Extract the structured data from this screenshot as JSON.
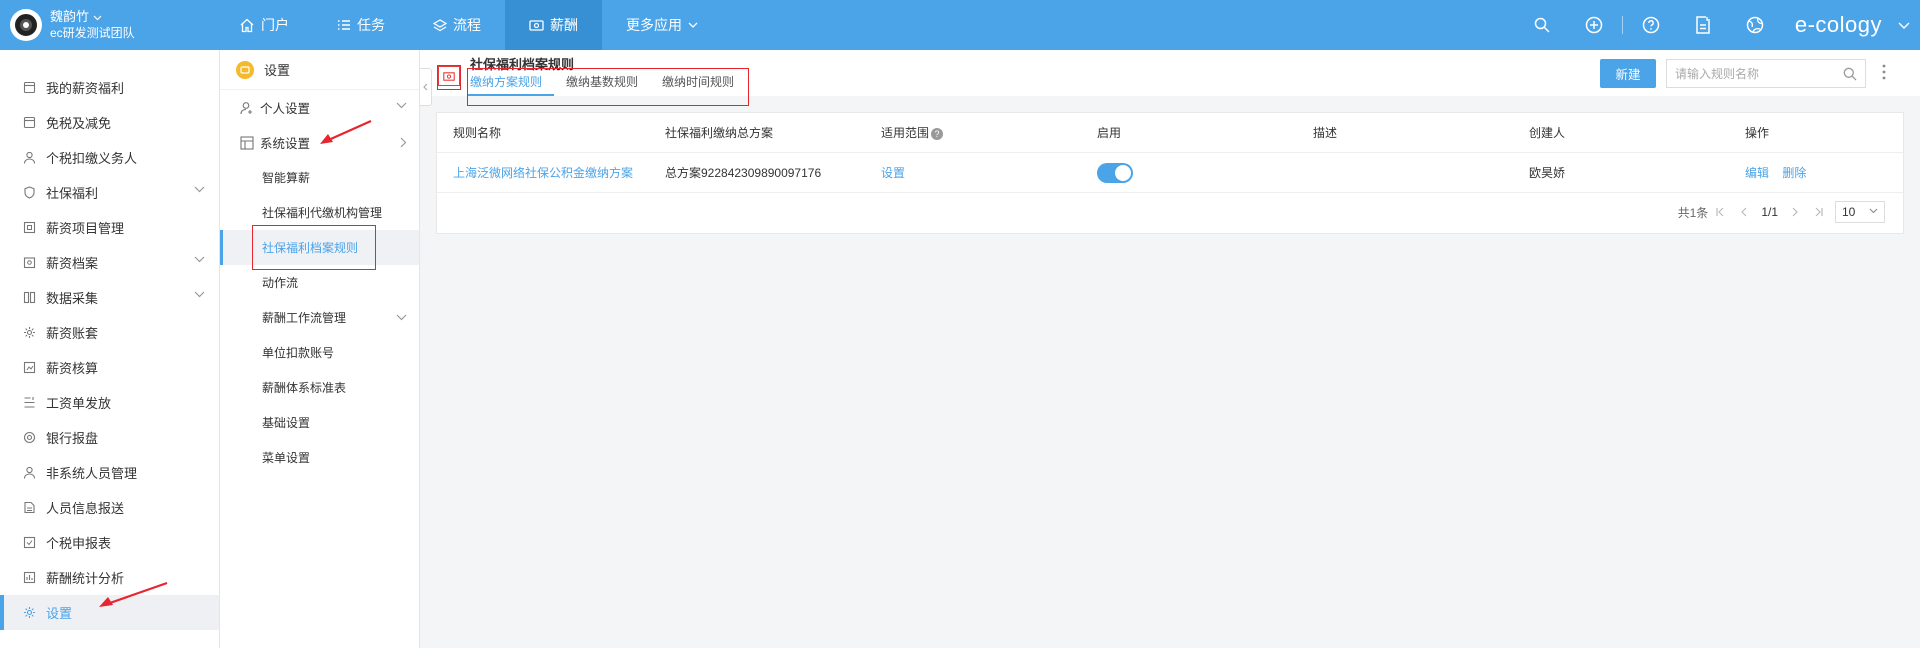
{
  "user": {
    "name": "魏韵竹",
    "team": "ec研发测试团队"
  },
  "nav": [
    {
      "label": "门户",
      "icon": "home-icon"
    },
    {
      "label": "任务",
      "icon": "list-icon"
    },
    {
      "label": "流程",
      "icon": "layers-icon"
    },
    {
      "label": "薪酬",
      "icon": "money-icon",
      "active": true
    },
    {
      "label": "更多应用",
      "icon": "chevron-down-icon"
    }
  ],
  "brand": "e-cology",
  "left_menu": [
    {
      "label": "我的薪资福利",
      "icon": "mail-icon"
    },
    {
      "label": "免税及减免",
      "icon": "mail-icon"
    },
    {
      "label": "个税扣缴义务人",
      "icon": "user-icon"
    },
    {
      "label": "社保福利",
      "icon": "shield-icon",
      "expandable": true
    },
    {
      "label": "薪资项目管理",
      "icon": "grid-icon"
    },
    {
      "label": "薪资档案",
      "icon": "folder-icon",
      "expandable": true
    },
    {
      "label": "数据采集",
      "icon": "data-icon",
      "expandable": true
    },
    {
      "label": "薪资账套",
      "icon": "gear-icon"
    },
    {
      "label": "薪资核算",
      "icon": "calc-icon"
    },
    {
      "label": "工资单发放",
      "icon": "send-icon"
    },
    {
      "label": "银行报盘",
      "icon": "at-icon"
    },
    {
      "label": "非系统人员管理",
      "icon": "user-icon"
    },
    {
      "label": "人员信息报送",
      "icon": "doc-icon"
    },
    {
      "label": "个税申报表",
      "icon": "table-icon"
    },
    {
      "label": "薪酬统计分析",
      "icon": "chart-icon"
    },
    {
      "label": "设置",
      "icon": "gear-icon",
      "active": true
    }
  ],
  "second_menu": {
    "header": "设置",
    "personal": "个人设置",
    "system": "系统设置",
    "items": [
      "智能算薪",
      "社保福利代缴机构管理",
      "社保福利档案规则",
      "动作流",
      "薪酬工作流管理",
      "单位扣款账号",
      "薪酬体系标准表",
      "基础设置",
      "菜单设置"
    ]
  },
  "main": {
    "title": "社保福利档案规则",
    "tabs": [
      "缴纳方案规则",
      "缴纳基数规则",
      "缴纳时间规则"
    ],
    "new_button": "新建",
    "search_placeholder": "请输入规则名称",
    "columns": [
      "规则名称",
      "社保福利缴纳总方案",
      "适用范围",
      "启用",
      "描述",
      "创建人",
      "操作"
    ],
    "help_mark": "?",
    "rows": [
      {
        "name": "上海泛微网络社保公积金缴纳方案",
        "scheme": "总方案922842309890097176",
        "scope": "设置",
        "enabled": true,
        "desc": "",
        "creator": "欧昊娇",
        "edit": "编辑",
        "delete": "删除"
      }
    ],
    "pager": {
      "total": "共1条",
      "page": "1/1",
      "size": "10"
    }
  },
  "colors": {
    "primary": "#4ba3e8",
    "annotation": "#e8242e"
  }
}
